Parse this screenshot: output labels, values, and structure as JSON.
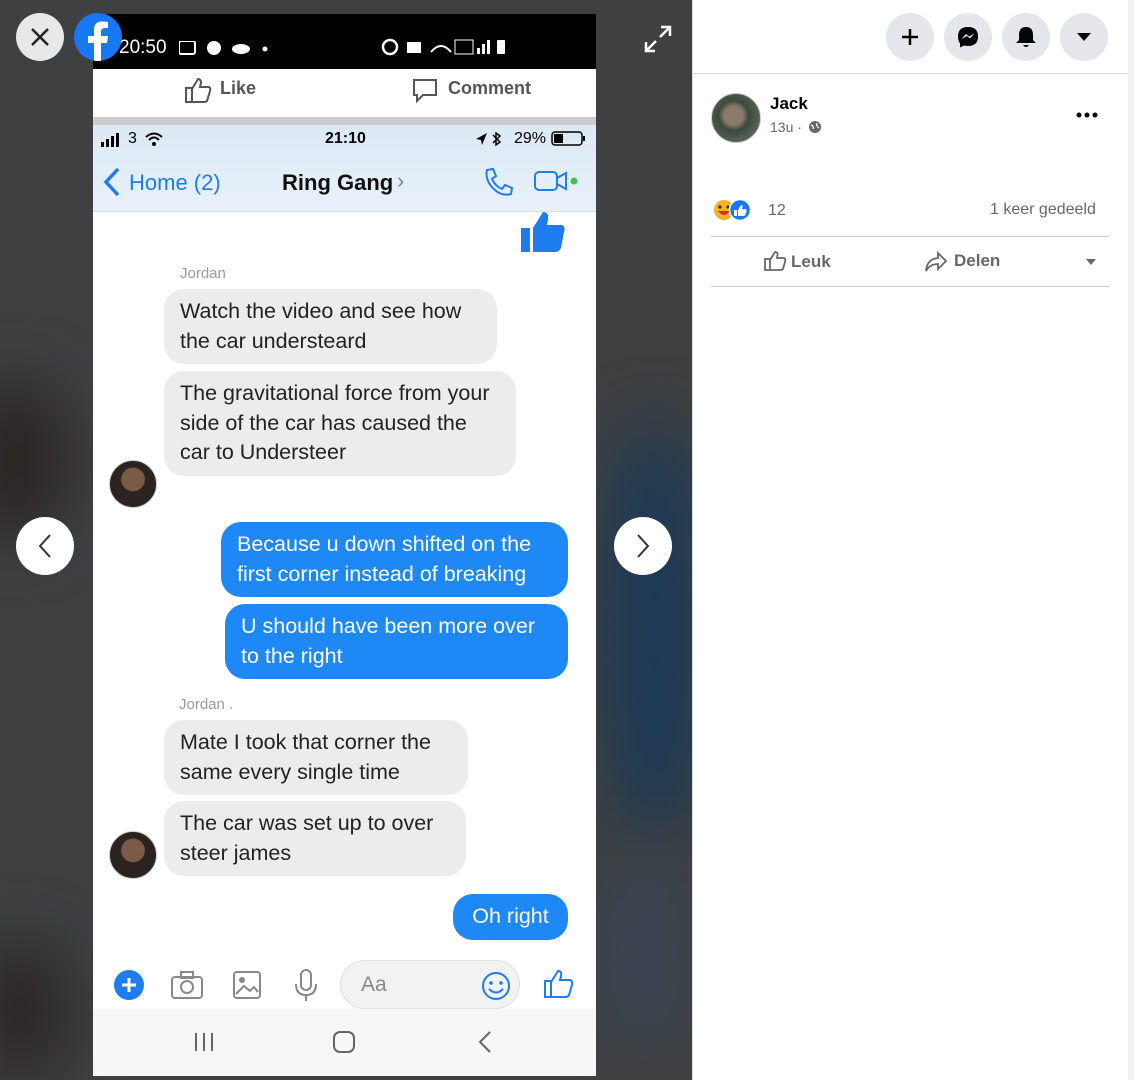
{
  "viewer": {
    "close_icon": "close-icon",
    "logo": "facebook-logo",
    "expand_icon": "expand-icon",
    "prev_icon": "chevron-left-icon",
    "next_icon": "chevron-right-icon"
  },
  "screenshot": {
    "android_status": {
      "time": "20:50"
    },
    "fb_actions": {
      "like": "Like",
      "comment": "Comment"
    },
    "ios_status": {
      "carrier": "3",
      "time": "21:10",
      "battery": "29%"
    },
    "chat_header": {
      "back": "Home (2)",
      "title": "Ring Gang",
      "chevron": "›"
    },
    "messages": {
      "sender1": "Jordan",
      "m1": "Watch the video and see how the car understeard",
      "m2": "The gravitational force from your side of the car has caused the car to Understeer",
      "m3": "Because u down shifted on the first corner instead of breaking",
      "m4": "U should have been more over to the right",
      "sender2": "Jordan .",
      "m5": "Mate I took that corner the same every single time",
      "m6": "The car was set up to over steer james",
      "m7": "Oh right"
    },
    "composer": {
      "placeholder": "Aa"
    }
  },
  "post": {
    "author": "Jack",
    "meta": "13u ·",
    "reaction_count": "12",
    "shares": "1 keer gedeeld",
    "like_label": "Leuk",
    "share_label": "Delen"
  },
  "colors": {
    "facebook_blue": "#1877f2",
    "messenger_blue": "#1e88f7"
  }
}
